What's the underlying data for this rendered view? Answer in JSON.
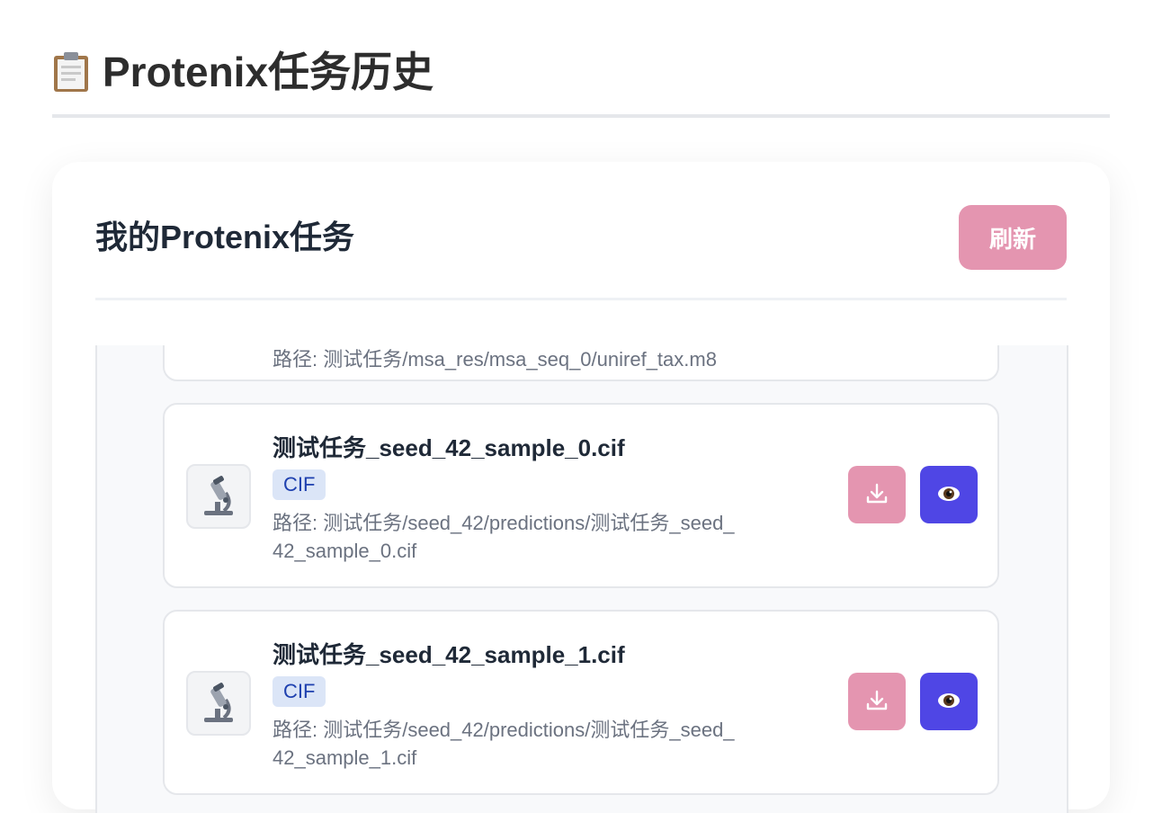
{
  "page": {
    "title": "Protenix任务历史",
    "title_icon": "clipboard-icon"
  },
  "card": {
    "title": "我的Protenix任务",
    "refresh_label": "刷新"
  },
  "colors": {
    "accent_pink": "#e495b0",
    "accent_indigo": "#4f46e5",
    "badge_bg": "#dbe5f7",
    "badge_text": "#1e40af"
  },
  "files": {
    "partial": {
      "path": "路径: 测试任务/msa_res/msa_seq_0/uniref_tax.m8"
    },
    "items": [
      {
        "name": "测试任务_seed_42_sample_0.cif",
        "badge": "CIF",
        "path": "路径: 测试任务/seed_42/predictions/测试任务_seed_42_sample_0.cif",
        "icon": "microscope-icon"
      },
      {
        "name": "测试任务_seed_42_sample_1.cif",
        "badge": "CIF",
        "path": "路径: 测试任务/seed_42/predictions/测试任务_seed_42_sample_1.cif",
        "icon": "microscope-icon"
      }
    ]
  }
}
